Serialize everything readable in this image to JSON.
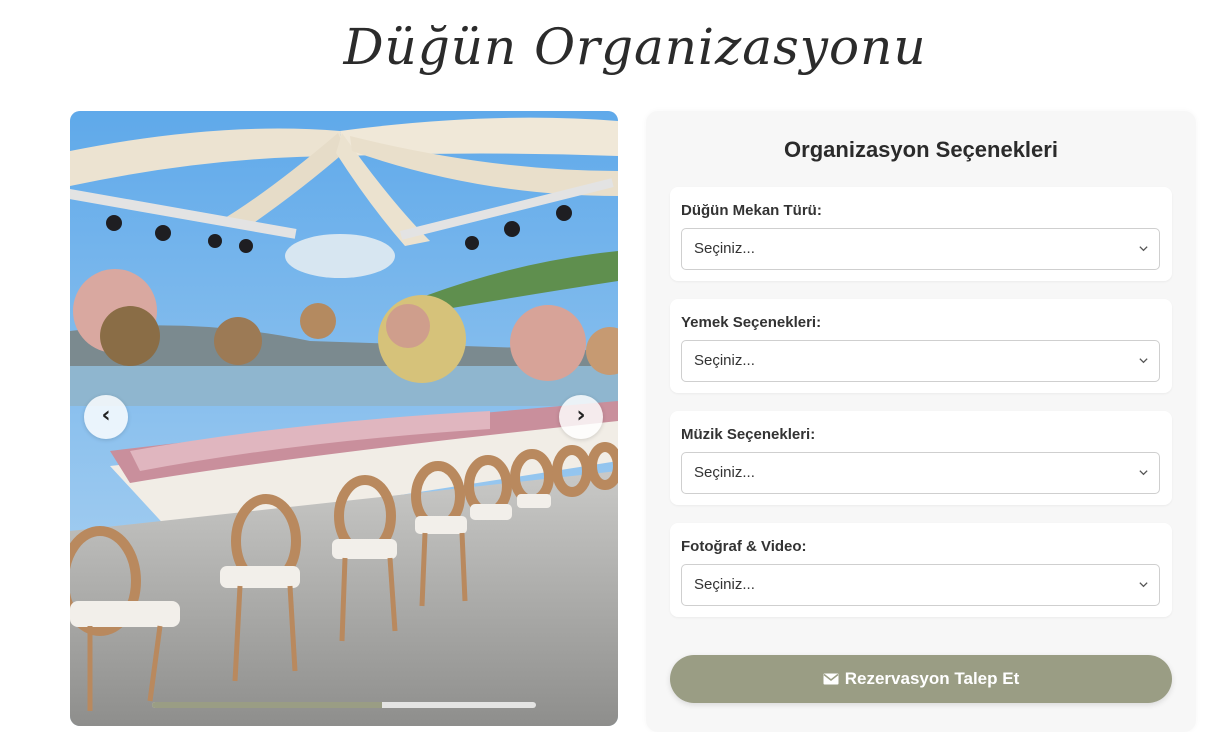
{
  "page": {
    "title": "Düğün Organizasyonu"
  },
  "slider": {
    "prev_icon": "‹",
    "next_icon": "›",
    "progress": 0.6
  },
  "options": {
    "title": "Organizasyon Seçenekleri",
    "groups": [
      {
        "label": "Düğün Mekan Türü:",
        "value": "Seçiniz..."
      },
      {
        "label": "Yemek Seçenekleri:",
        "value": "Seçiniz..."
      },
      {
        "label": "Müzik Seçenekleri:",
        "value": "Seçiniz..."
      },
      {
        "label": "Fotoğraf & Video:",
        "value": "Seçiniz..."
      }
    ],
    "submit_label": "Rezervasyon Talep Et",
    "submit_icon": "envelope-icon"
  },
  "colors": {
    "accent": "#9a9d84",
    "panel_bg": "#f7f7f7",
    "text": "#2b2b2b"
  }
}
